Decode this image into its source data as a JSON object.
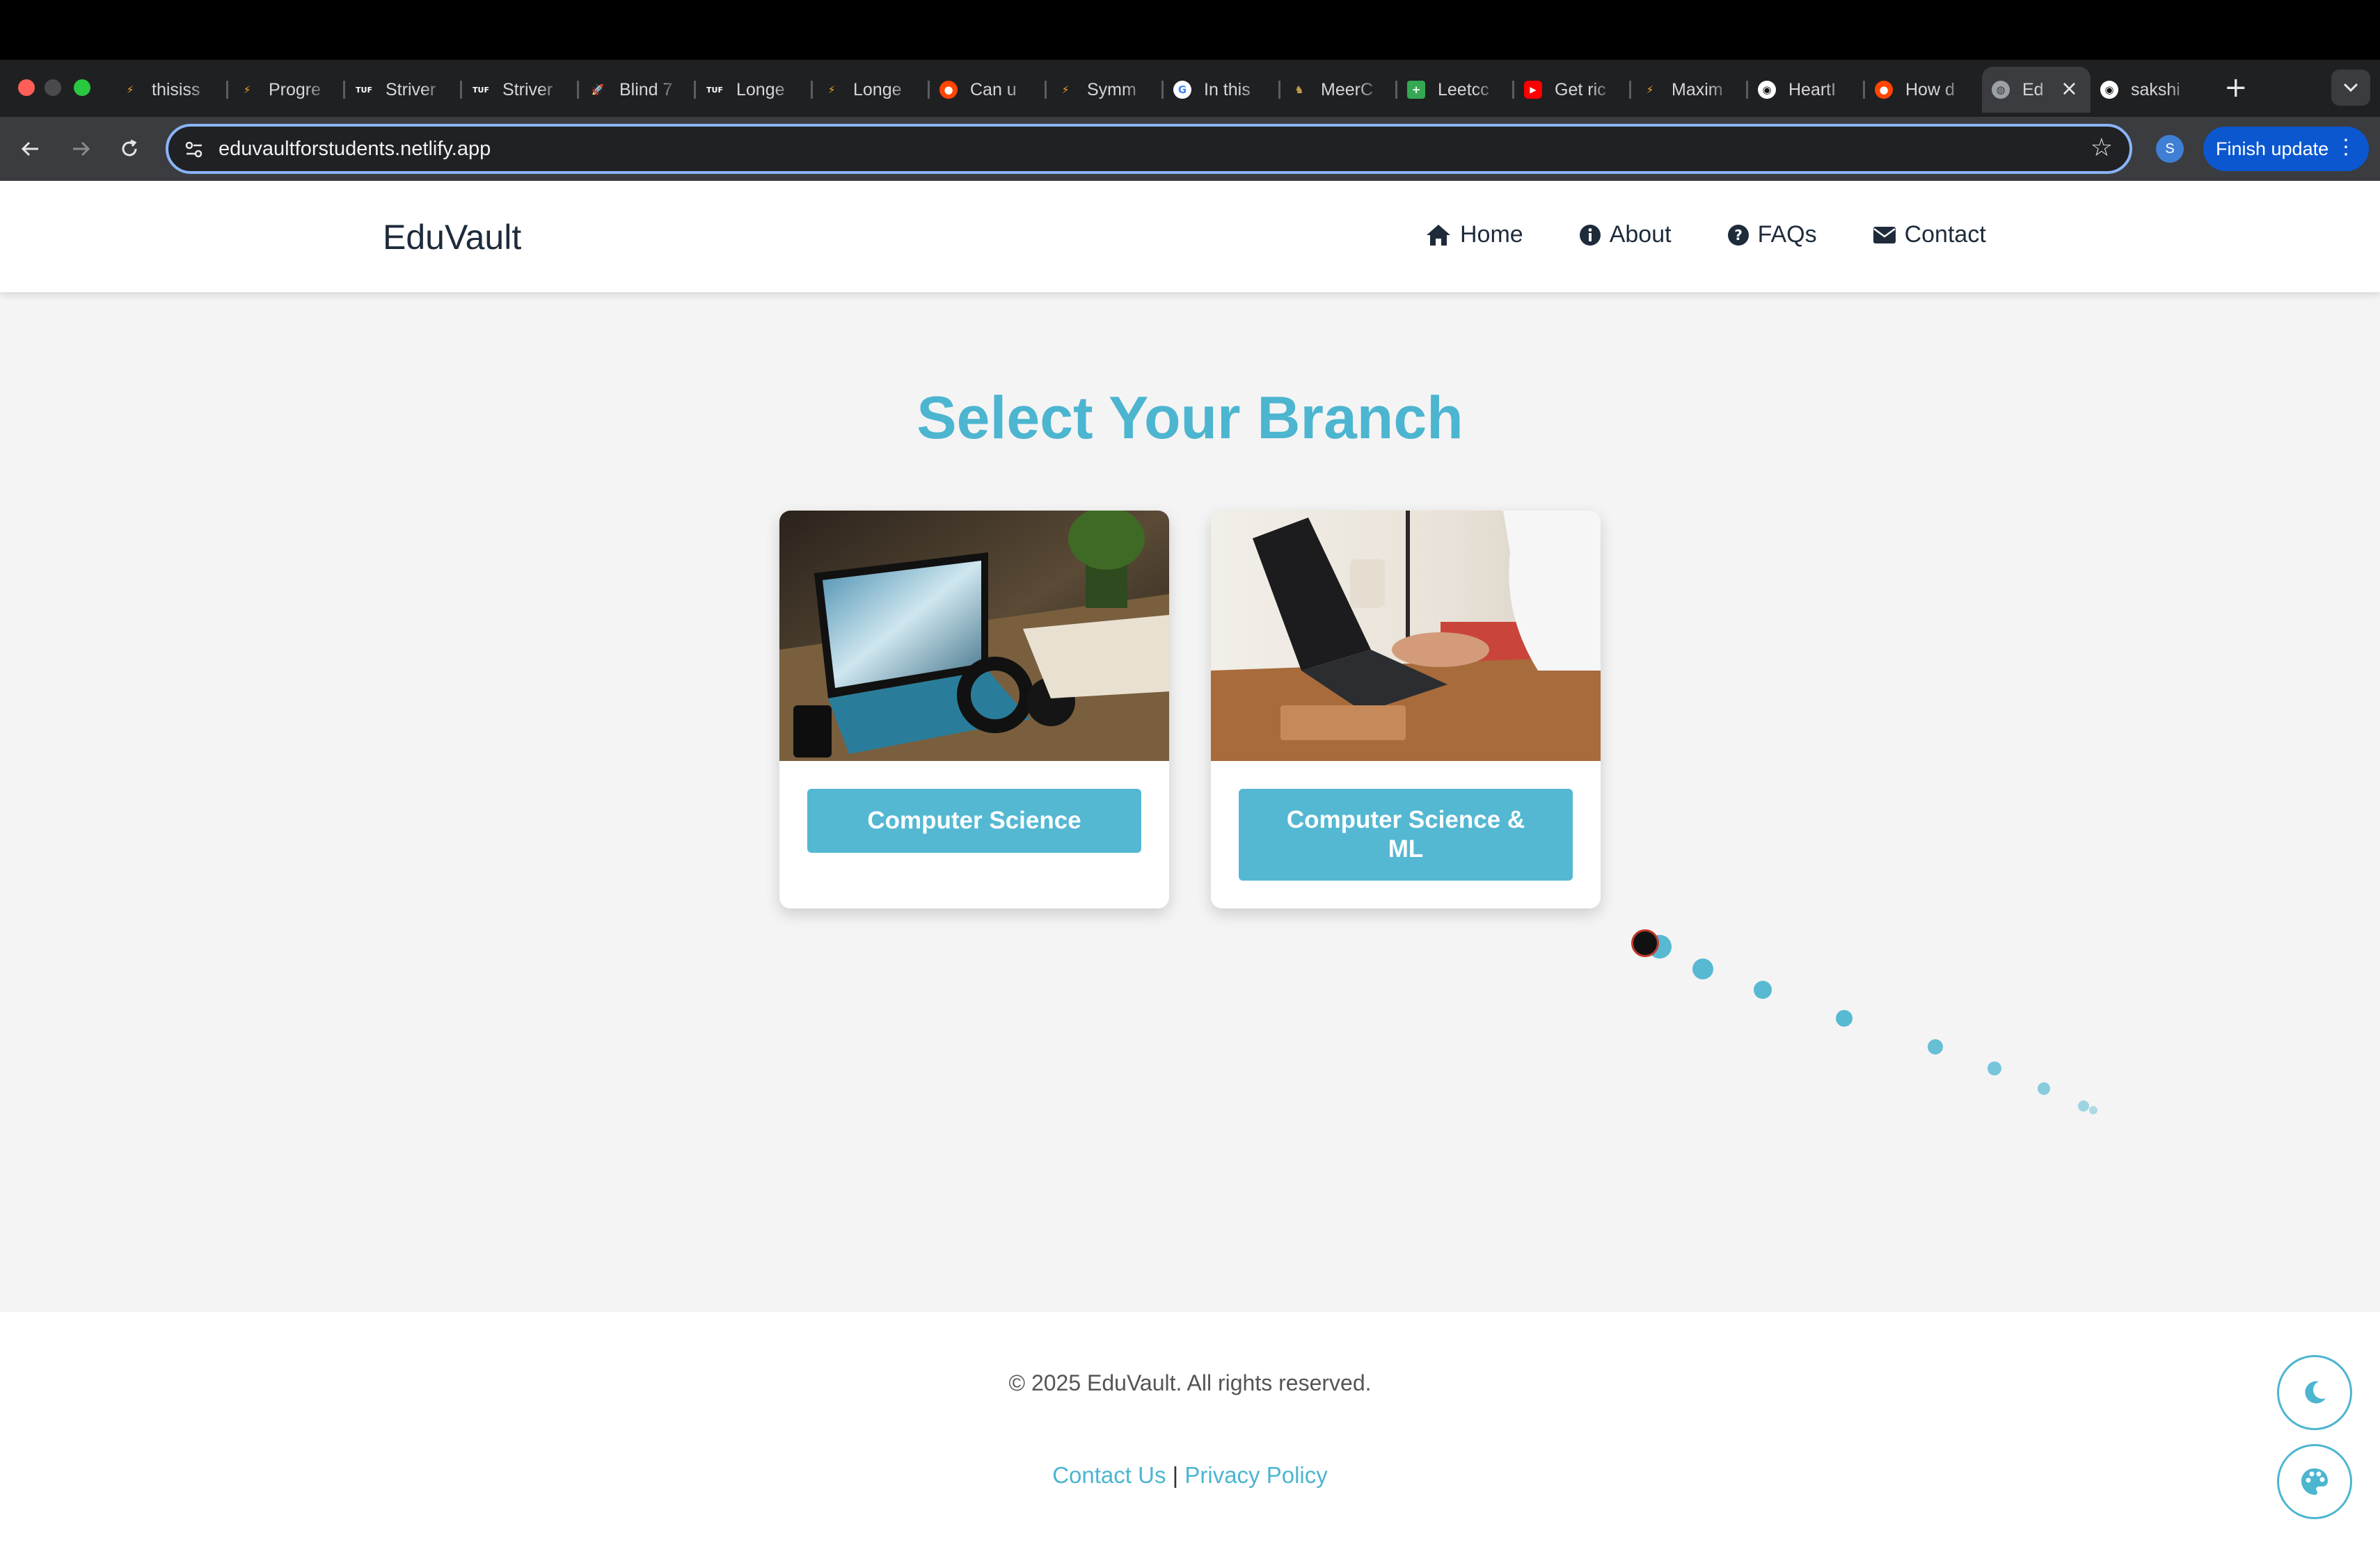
{
  "browser": {
    "tabs": [
      {
        "title": "thisiss",
        "icon": "tuf-flame-icon",
        "color": "#f5a623"
      },
      {
        "title": "Progre",
        "icon": "tuf-flame-icon",
        "color": "#f5a623"
      },
      {
        "title": "Striver",
        "icon": "tuf-logo-icon",
        "color": "#111111"
      },
      {
        "title": "Striver",
        "icon": "tuf-logo-icon",
        "color": "#111111"
      },
      {
        "title": "Blind 7",
        "icon": "rocket-icon",
        "color": "#6b5bd6"
      },
      {
        "title": "Longe",
        "icon": "tuf-logo-icon",
        "color": "#111111"
      },
      {
        "title": "Longe",
        "icon": "tuf-flame-icon",
        "color": "#f5a623"
      },
      {
        "title": "Can u",
        "icon": "reddit-icon",
        "color": "#ff4500"
      },
      {
        "title": "Symm",
        "icon": "tuf-flame-icon",
        "color": "#f5a623"
      },
      {
        "title": "In this",
        "icon": "google-icon",
        "color": "#ffffff"
      },
      {
        "title": "MeerC",
        "icon": "meerc-icon",
        "color": "#c8a048"
      },
      {
        "title": "Leetcc",
        "icon": "sheets-icon",
        "color": "#34a853"
      },
      {
        "title": "Get ric",
        "icon": "youtube-icon",
        "color": "#ff0000"
      },
      {
        "title": "Maxim",
        "icon": "tuf-flame-icon",
        "color": "#f5a623"
      },
      {
        "title": "HeartI",
        "icon": "github-icon",
        "color": "#ffffff"
      },
      {
        "title": "How d",
        "icon": "reddit-icon",
        "color": "#ff4500"
      },
      {
        "title": "Ed",
        "icon": "globe-icon",
        "color": "#9aa0a6",
        "active": true
      },
      {
        "title": "sakshi",
        "icon": "github-icon",
        "color": "#ffffff"
      }
    ],
    "url": "eduvaultforstudents.netlify.app",
    "profile_initial": "S",
    "finish_update_label": "Finish update"
  },
  "site": {
    "brand": "EduVault",
    "nav": [
      {
        "label": "Home",
        "icon": "home-icon"
      },
      {
        "label": "About",
        "icon": "info-icon"
      },
      {
        "label": "FAQs",
        "icon": "question-icon"
      },
      {
        "label": "Contact",
        "icon": "envelope-icon"
      }
    ]
  },
  "main": {
    "title": "Select Your Branch",
    "branches": [
      {
        "label": "Computer Science",
        "image": "laptop-desk-photo"
      },
      {
        "label": "Computer Science & ML",
        "image": "typing-laptop-photo"
      }
    ]
  },
  "footer": {
    "copyright": "© 2025 EduVault. All rights reserved.",
    "contact_link": "Contact Us",
    "separator": "|",
    "privacy_link": "Privacy Policy"
  },
  "colors": {
    "accent": "#4cb5d0",
    "button": "#54b8d3",
    "text_dark": "#1e2b3b"
  }
}
